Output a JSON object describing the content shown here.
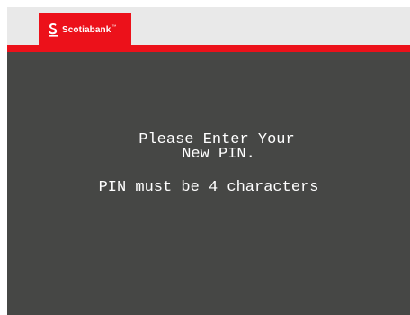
{
  "branding": {
    "logo_name": "Scotiabank",
    "logo_tm": "™",
    "colors": {
      "brand_red": "#ec111a",
      "screen_background": "#464745",
      "header_background": "#e9e9e9",
      "text": "#ffffff"
    },
    "icon": "scotiabank-s-logo-icon"
  },
  "prompt": {
    "line1": "Please Enter Your",
    "line2": "New PIN.",
    "requirement": "PIN must be 4 characters"
  }
}
